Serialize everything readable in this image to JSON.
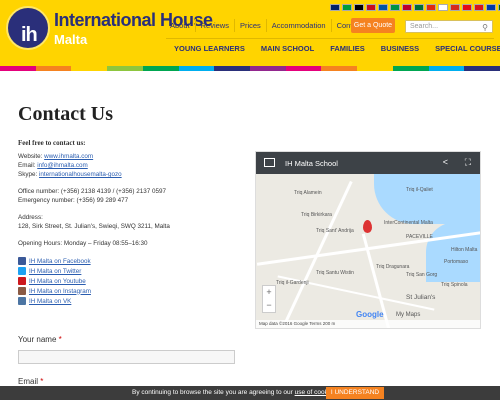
{
  "brand": {
    "title": "International House",
    "subtitle": "Malta",
    "logo_text": "ih"
  },
  "topnav": [
    "About",
    "Reviews",
    "Prices",
    "Accommodation",
    "Contact Us"
  ],
  "quote_button": "Get a Quote",
  "search": {
    "placeholder": "Search..."
  },
  "mainnav": [
    "YOUNG LEARNERS",
    "MAIN SCHOOL",
    "FAMILIES",
    "BUSINESS",
    "SPECIAL COURSES"
  ],
  "colors": {
    "header": "#ffd400",
    "brand_blue": "#2a2f7a",
    "accent_orange": "#f58220",
    "link": "#2a5db0"
  },
  "page": {
    "title": "Contact Us"
  },
  "contact": {
    "heading": "Feel free to contact us:",
    "website_label": "Website:",
    "website": "www.ihmalta.com",
    "email_label": "Email:",
    "email": "info@ihmalta.com",
    "skype_label": "Skype:",
    "skype": "internationalhousemalta-gozo",
    "office": "Office number: (+356) 2138 4139 / (+356) 2137 0597",
    "emergency": "Emergency number: (+356) 99 289 477",
    "address_label": "Address:",
    "address": "128, Sirk Street, St. Julian's, Swieqi, SWQ 3211, Malta",
    "hours": "Opening Hours: Monday – Friday 08:55–16:30",
    "social": [
      {
        "label": "IH Malta on Facebook",
        "icon": "facebook-icon",
        "color": "#3b5998"
      },
      {
        "label": "IH Malta on Twitter",
        "icon": "twitter-icon",
        "color": "#1da1f2"
      },
      {
        "label": "IH Malta on Youtube",
        "icon": "youtube-icon",
        "color": "#cc181e"
      },
      {
        "label": "IH Malta on Instagram",
        "icon": "instagram-icon",
        "color": "#8a5a44"
      },
      {
        "label": "IH Malta on VK",
        "icon": "vk-icon",
        "color": "#4c75a3"
      }
    ]
  },
  "form": {
    "name_label": "Your name",
    "email_label": "Email",
    "required_mark": "*"
  },
  "map": {
    "title": "IH Malta School",
    "footer": "Map data ©2016 Google   Terms   200 m",
    "google": "Google",
    "my_maps": "My Maps",
    "labels": [
      "Triq il-Qaliet",
      "InterContinental Malta",
      "PACEVILLE",
      "St Julian's",
      "Triq Santu Wistin",
      "Triq San Gorg",
      "Hilton Malta",
      "Portomaso",
      "Triq Sant' Andrija",
      "Triq Alamein",
      "Triq il-Gardenji",
      "Triq Birkirkara",
      "Triq Dragunara",
      "Triq Spinola"
    ]
  },
  "cookie": {
    "text": "By continuing to browse the site you are agreeing to our",
    "link": "use of cookies",
    "button": "I UNDERSTAND"
  }
}
